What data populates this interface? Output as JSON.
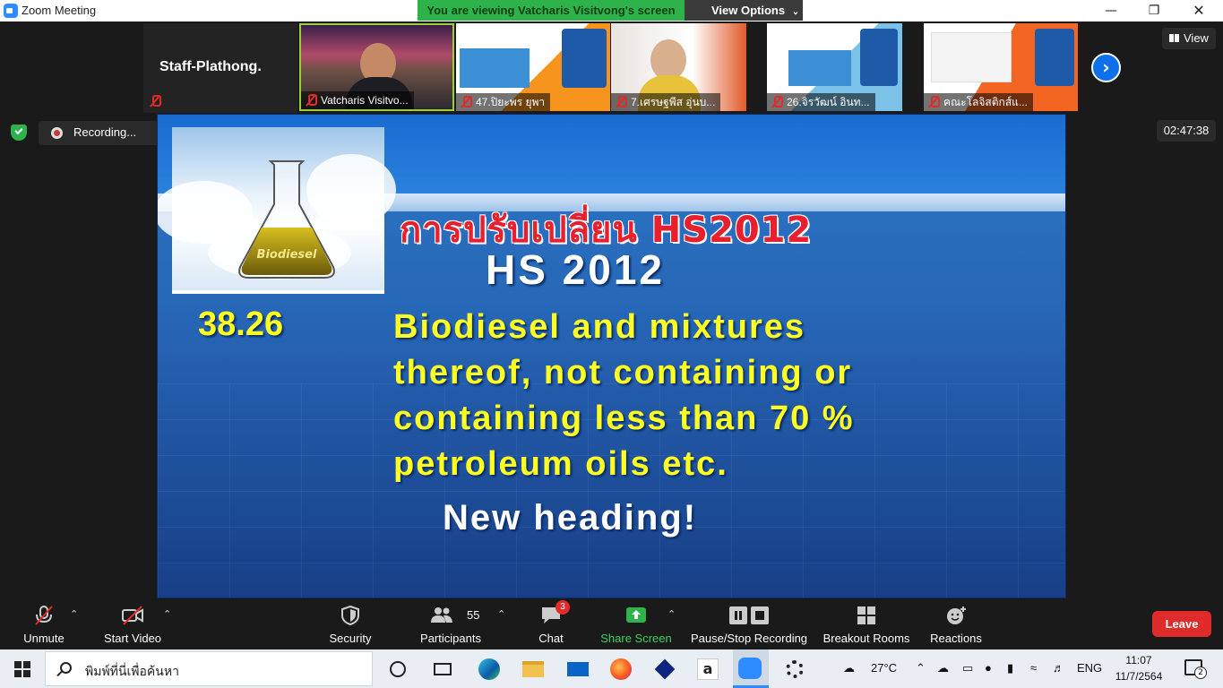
{
  "window": {
    "title": "Zoom Meeting",
    "viewing_banner": "You are viewing Vatcharis Visitvong's screen",
    "view_options": "View Options"
  },
  "gallery": {
    "self_name": "Staff-Plathong.",
    "participants": [
      {
        "label": "Vatcharis Visitvo..."
      },
      {
        "label": "47.ปิยะพร ยุพา"
      },
      {
        "label": "7.เศรษฐพีส อุ่นบ..."
      },
      {
        "label": "26.จิรวัฒน์ อินท..."
      },
      {
        "label": "คณะโลจิสติกส์แ..."
      }
    ],
    "view_button": "View"
  },
  "recording": {
    "status": "Recording...",
    "timer": "02:47:38"
  },
  "slide": {
    "title_thai": "การปรับเปลี่ยน HS2012",
    "subtitle": "HS 2012",
    "flask_label": "Biodiesel",
    "heading_code": "38.26",
    "body_lines": [
      "Biodiesel and mixtures",
      "thereof, not containing or",
      "containing less than 70 %",
      "petroleum oils etc."
    ],
    "note": "New heading!"
  },
  "toolbar": {
    "unmute": "Unmute",
    "start_video": "Start Video",
    "security": "Security",
    "participants": "Participants",
    "participants_count": "55",
    "chat": "Chat",
    "chat_badge": "3",
    "share_screen": "Share Screen",
    "pause_stop_recording": "Pause/Stop Recording",
    "breakout_rooms": "Breakout Rooms",
    "reactions": "Reactions",
    "leave": "Leave"
  },
  "taskbar": {
    "search_placeholder": "พิมพ์ที่นี่เพื่อค้นหา",
    "weather": "27°C",
    "language": "ENG",
    "time": "11:07",
    "date": "11/7/2564",
    "notifications": "2"
  },
  "colors": {
    "zoom_blue": "#2d8cff",
    "green": "#2eb34a",
    "leave_red": "#e02b2b",
    "slide_yellow": "#ffff22"
  }
}
